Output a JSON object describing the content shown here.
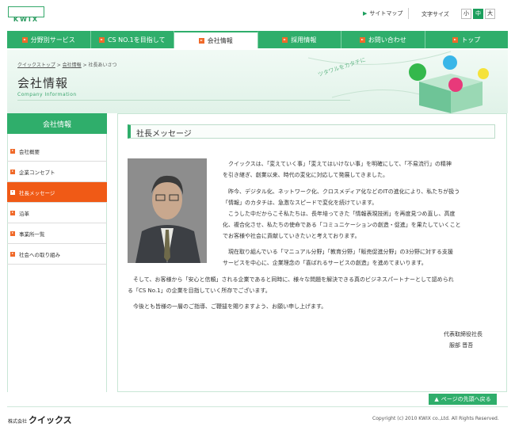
{
  "header": {
    "logo_text": "KWIX",
    "sitemap_label": "サイトマップ",
    "fontsize_label": "文字サイズ",
    "fontsize_options": [
      "小",
      "中",
      "大"
    ],
    "fontsize_selected": "中"
  },
  "nav": {
    "items": [
      {
        "label": "分野別サービス"
      },
      {
        "label": "CS NO.1を目指して"
      },
      {
        "label": "会社情報"
      },
      {
        "label": "採用情報"
      },
      {
        "label": "お問い合わせ"
      },
      {
        "label": "トップ"
      }
    ],
    "active": "会社情報"
  },
  "banner": {
    "breadcrumb": [
      "クイックストップ",
      "会社情報",
      "社長あいさつ"
    ],
    "title": "会社情報",
    "subtitle": "Company Information",
    "deco_text": "ツタワルをカタチに"
  },
  "sidebar": {
    "title": "会社情報",
    "items": [
      {
        "label": "会社概要"
      },
      {
        "label": "企業コンセプト"
      },
      {
        "label": "社長メッセージ"
      },
      {
        "label": "沿革"
      },
      {
        "label": "事業所一覧"
      },
      {
        "label": "社会への取り組み"
      }
    ],
    "active": "社長メッセージ"
  },
  "content": {
    "section_title": "社長メッセージ",
    "p1": [
      "　クイックスは、「変えていく事」「変えてはいけない事」を明確にして、「不易流行」の精神",
      "を引き継ぎ、創業以来、時代の変化に対応して発展してきました。"
    ],
    "p2": [
      "　昨今、デジタル化、ネットワーク化、クロスメディア化などのITの進化により、私たちが扱う",
      "「情報」のカタチは、急激なスピードで変化を続けています。",
      "　こうした中だからこそ私たちは、長年培ってきた「情報表現技術」を再度見つめ直し、高度",
      "化、複合化させ、私たちの使命である「コミュニケーションの創造・促進」を果たしていくこと",
      "でお客様や社会に貢献していきたいと考えております。"
    ],
    "p3": [
      "　現在取り組んでいる「マニュアル分野」「教育分野」「販売促進分野」の3分野に対する支援",
      "サービスを中心に、企業理念の「喜ばれるサービスの創造」を進めてまいります。"
    ],
    "p4": [
      "　そして、お客様から「安心と信頼」される企業であると同時に、様々な問題を解決できる真のビジネスパートナーとして認められ",
      "る「CS No.1」の企業を目指していく所存でございます。"
    ],
    "p5": "　今後とも皆様の一層のご指導、ご鞭撻を賜りますよう、お願い申し上げます。",
    "signature_title": "代表取締役社長",
    "signature_name": "服部 晋吾"
  },
  "footer": {
    "pagetop_label": "ページの先頭へ戻る",
    "logo_prefix": "株式会社",
    "logo_name": "クイックス",
    "copyright": "Copyright (c) 2010 KWIX co.,Ltd. All Rights Reserved."
  },
  "colors": {
    "brand_green": "#2fae6b",
    "accent_orange": "#f05a16"
  }
}
